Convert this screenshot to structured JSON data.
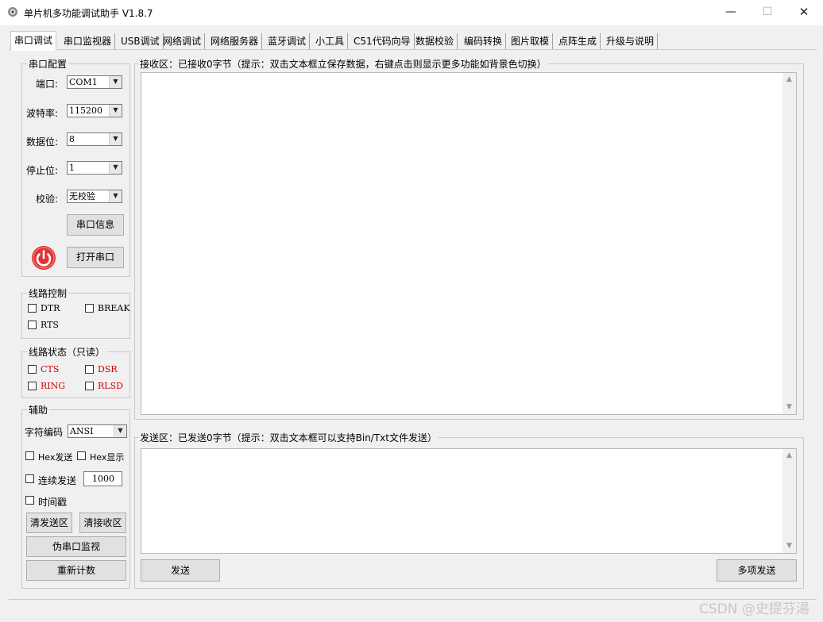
{
  "window": {
    "title": "单片机多功能调试助手 V1.8.7",
    "minimize_glyph": "—",
    "maximize_glyph": "☐",
    "close_glyph": "✕"
  },
  "tabs": [
    {
      "label": "串口调试",
      "active": true
    },
    {
      "label": "串口监视器"
    },
    {
      "label": "USB调试"
    },
    {
      "label": "网络调试"
    },
    {
      "label": "网络服务器"
    },
    {
      "label": "蓝牙调试"
    },
    {
      "label": "小工具"
    },
    {
      "label": "C51代码向导"
    },
    {
      "label": "数据校验"
    },
    {
      "label": "编码转换"
    },
    {
      "label": "图片取模"
    },
    {
      "label": "点阵生成"
    },
    {
      "label": "升级与说明"
    }
  ],
  "serial_config": {
    "title": "串口配置",
    "port_label": "端口:",
    "port_value": "COM1",
    "baud_label": "波特率:",
    "baud_value": "115200",
    "databits_label": "数据位:",
    "databits_value": "8",
    "stopbits_label": "停止位:",
    "stopbits_value": "1",
    "parity_label": "校验:",
    "parity_value": "无校验",
    "info_button": "串口信息",
    "open_button": "打开串口"
  },
  "line_control": {
    "title": "线路控制",
    "dtr": "DTR",
    "break": "BREAK",
    "rts": "RTS"
  },
  "line_status": {
    "title": "线路状态（只读）",
    "cts": "CTS",
    "dsr": "DSR",
    "ring": "RING",
    "rlsd": "RLSD"
  },
  "assist": {
    "title": "辅助",
    "encoding_label": "字符编码",
    "encoding_value": "ANSI",
    "hex_send": "Hex发送",
    "hex_display": "Hex显示",
    "continuous_send": "连续发送",
    "interval_value": "1000",
    "timestamp": "时间戳",
    "clear_send_button": "清发送区",
    "clear_recv_button": "清接收区",
    "pseudo_monitor_button": "伪串口监视",
    "recount_button": "重新计数"
  },
  "receive": {
    "title": "接收区：已接收0字节（提示：双击文本框立保存数据，右键点击则显示更多功能如背景色切换）"
  },
  "send": {
    "title": "发送区：已发送0字节（提示：双击文本框可以支持Bin/Txt文件发送）",
    "send_button": "发送",
    "multi_send_button": "多项发送"
  },
  "watermark": "CSDN @史提芬湯",
  "colors": {
    "power_icon": "#e03434",
    "status_text": "#d40000"
  }
}
